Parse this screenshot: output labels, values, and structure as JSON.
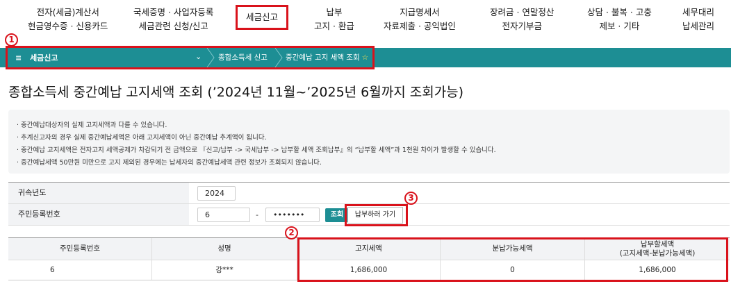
{
  "top_menu": {
    "items": [
      {
        "line1": "전자(세금)계산서",
        "line2": "현금영수증 · 신용카드"
      },
      {
        "line1": "국세증명 · 사업자등록",
        "line2": "세금관련 신청/신고"
      },
      {
        "line1": "세금신고",
        "line2": ""
      },
      {
        "line1": "납부",
        "line2": "고지 · 환급"
      },
      {
        "line1": "지급명세서",
        "line2": "자료제출 · 공익법인"
      },
      {
        "line1": "장려금 · 연말정산",
        "line2": "전자기부금"
      },
      {
        "line1": "상담 · 불복 · 고충",
        "line2": "제보 · 기타"
      },
      {
        "line1": "세무대리",
        "line2": "납세관리"
      }
    ]
  },
  "breadcrumb": {
    "home_icon": "hamburger-menu",
    "home": "세금신고",
    "level2": "종합소득세 신고",
    "level3": "중간예납 고지 세액 조회",
    "favorite_icon": "star-icon"
  },
  "annotations": {
    "badge1": "1",
    "badge2": "2",
    "badge3": "3"
  },
  "page": {
    "title": "종합소득세 중간예납 고지세액 조회 (’2024년 11월~’2025년 6월까지 조회가능)"
  },
  "notes": [
    "· 중간예납대상자의 실제 고지세액과 다를 수 있습니다.",
    "· 추계신고자의 경우 실제 중간예납세액은 아래 고지세액이 아닌 중간예납 추계액이 됩니다.",
    "· 중간예납 고지세액은 전자고지 세액공제가 차감되기 전 금액으로 『신고/납부 -> 국세납부 -> 납부할 세액 조회납부』의 “납부할 세액”과 1천원 차이가 발생할 수 있습니다.",
    "· 중간예납세액 50만원 미만으로 고지 제외된 경우에는 납세자의 중간예납세액 관련 정보가 조회되지 않습니다."
  ],
  "form": {
    "year_label": "귀속년도",
    "year_value": "2024",
    "rrn_label": "주민등록번호",
    "rrn_front": "6",
    "rrn_dash": "-",
    "rrn_back": "•••••••",
    "query_button": "조회",
    "pay_button": "납부하러 가기"
  },
  "result": {
    "headers": [
      "주민등록번호",
      "성명",
      "고지세액",
      "분납가능세액",
      "납부할세액",
      "(고지세액-분납가능세액)"
    ],
    "row": [
      "6",
      "강***",
      "1,686,000",
      "0",
      "1,686,000"
    ]
  },
  "colors": {
    "accent": "#1d8e94",
    "highlight": "#d9121b"
  }
}
